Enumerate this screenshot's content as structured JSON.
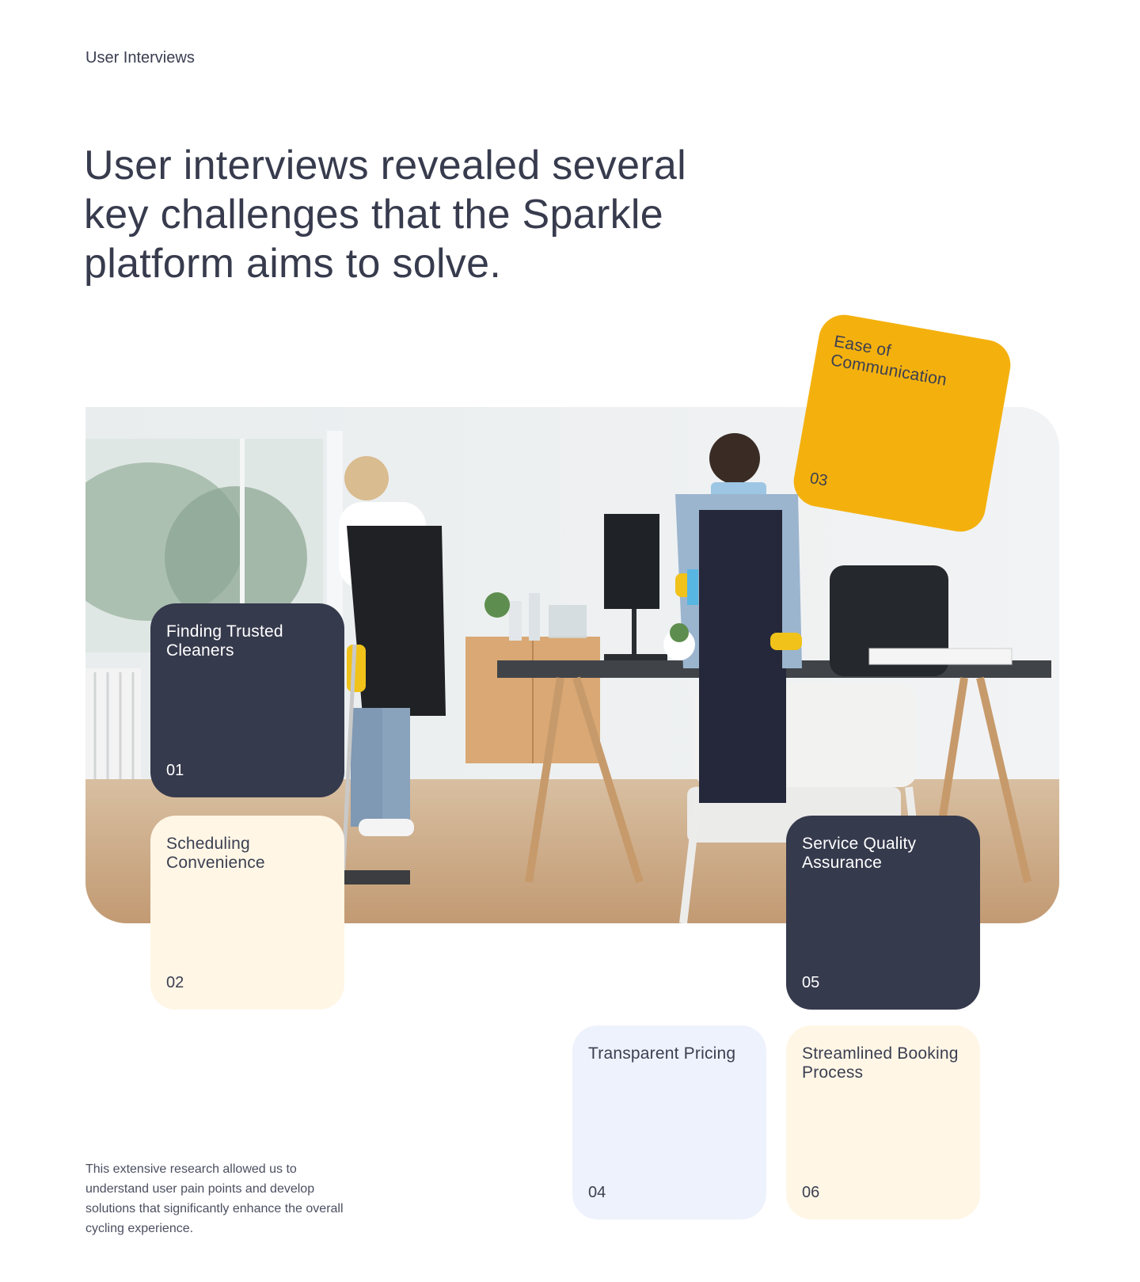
{
  "section_label": "User Interviews",
  "headline": "User interviews revealed several key challenges that the Sparkle platform aims to solve.",
  "photo_alt": "Two cleaners in masks cleaning an office",
  "cards": [
    {
      "id": "01",
      "title": "Finding Trusted Cleaners",
      "number": "01"
    },
    {
      "id": "02",
      "title": "Scheduling Convenience",
      "number": "02"
    },
    {
      "id": "03",
      "title": "Ease of Communication",
      "number": "03"
    },
    {
      "id": "04",
      "title": "Transparent Pricing",
      "number": "04"
    },
    {
      "id": "05",
      "title": "Service Quality Assurance",
      "number": "05"
    },
    {
      "id": "06",
      "title": "Streamlined Booking Process",
      "number": "06"
    }
  ],
  "footnote": "This extensive research allowed us to understand user pain points and develop solutions that significantly enhance the overall cycling experience.",
  "colors": {
    "dark": "#363a4d",
    "cream": "#fff6e6",
    "lavender": "#eef2fc",
    "yellow": "#f4b10e",
    "text": "#373b4d"
  }
}
